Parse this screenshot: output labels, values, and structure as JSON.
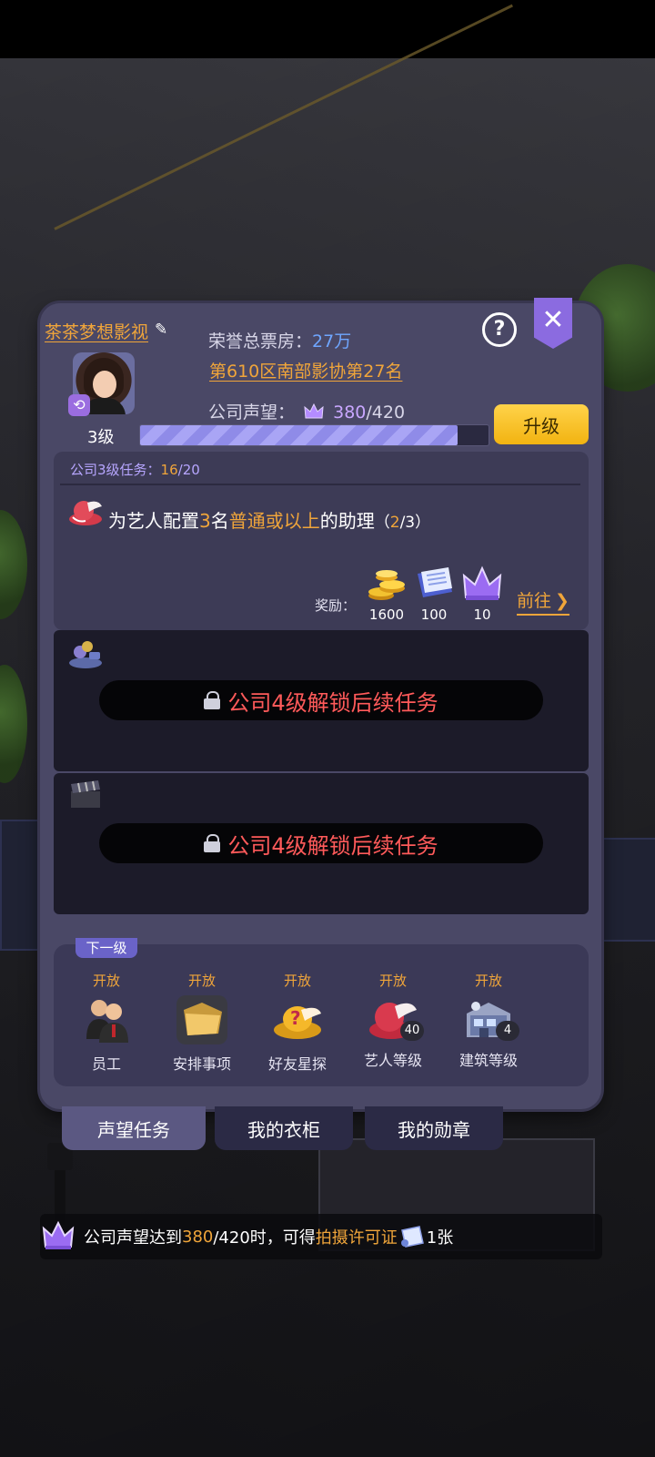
{
  "company": {
    "name": "茶茶梦想影视",
    "level": "3级"
  },
  "honor": {
    "label": "荣誉总票房：",
    "value": "27万"
  },
  "rank": "第610区南部影协第27名",
  "reputation": {
    "label": "公司声望：",
    "current": "380",
    "max": "/420",
    "progress": 0.91
  },
  "buttons": {
    "upgrade": "升级",
    "goto": "前往"
  },
  "task": {
    "header_prefix": "公司3级任务：",
    "done": "16",
    "total": "/20",
    "desc_1": "为艺人配置",
    "desc_num": "3",
    "desc_2": "名",
    "desc_hl": "普通或以上",
    "desc_3": "的助理",
    "progress_open": "（",
    "progress_done": "2",
    "progress_total": "/3）",
    "reward_label": "奖励：",
    "rewards": [
      {
        "icon": "gold-coins-icon",
        "value": "1600"
      },
      {
        "icon": "script-icon",
        "value": "100"
      },
      {
        "icon": "purple-crown-icon",
        "value": "10"
      }
    ]
  },
  "locked": [
    {
      "icon": "scout-icon",
      "text": "公司4级解锁后续任务"
    },
    {
      "icon": "clapperboard-icon",
      "text": "公司4级解锁后续任务"
    }
  ],
  "next_level": {
    "tag": "下一级",
    "features": [
      {
        "status": "开放",
        "name": "员工",
        "icon": "staff-icon"
      },
      {
        "status": "开放",
        "name": "安排事项",
        "icon": "folder-icon"
      },
      {
        "status": "开放",
        "name": "好友星探",
        "icon": "gold-hat-icon"
      },
      {
        "status": "开放",
        "name": "艺人等级",
        "icon": "red-hat-icon",
        "badge": "40"
      },
      {
        "status": "开放",
        "name": "建筑等级",
        "icon": "building-icon",
        "badge": "4"
      }
    ]
  },
  "tabs": [
    "声望任务",
    "我的衣柜",
    "我的勋章"
  ],
  "notice": {
    "prefix": "公司声望达到 ",
    "num": "380",
    "mid": "/420时，可得",
    "hl": "拍摄许可证",
    "suffix": "1张"
  }
}
